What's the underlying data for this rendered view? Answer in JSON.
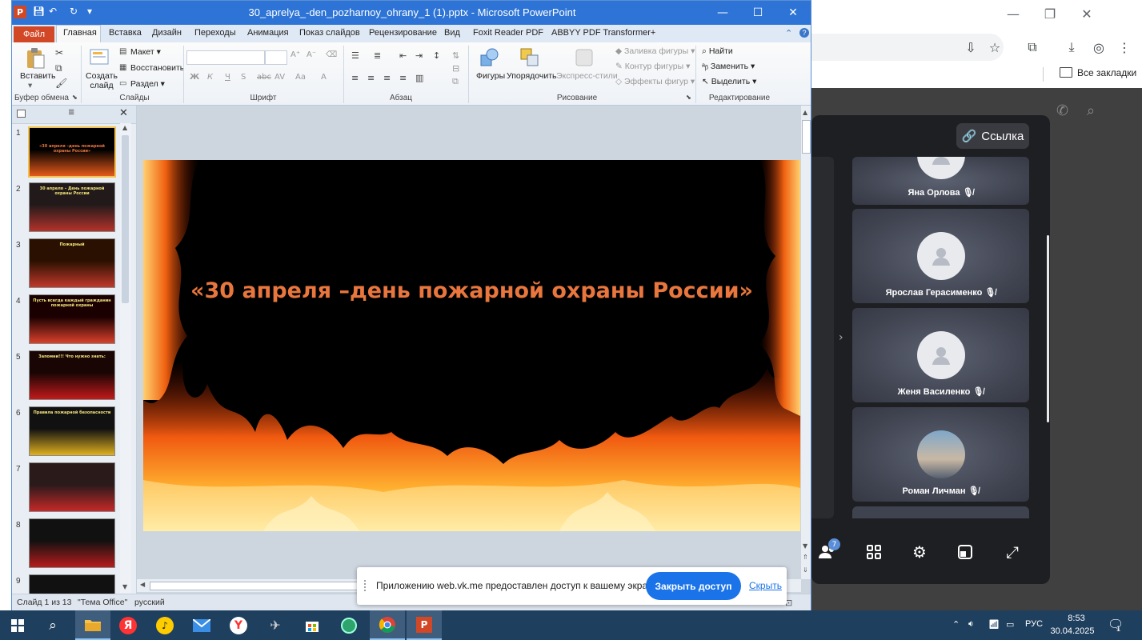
{
  "browser": {
    "bookmarks_label": "Все закладки",
    "vk": {
      "link_button": "Ссылка",
      "participants": [
        {
          "name": "Яна Орлова"
        },
        {
          "name": "Ярослав Герасименко"
        },
        {
          "name": "Женя Василенко"
        },
        {
          "name": "Роман Личман"
        }
      ],
      "participants_badge": "7"
    }
  },
  "ppt": {
    "title": "30_aprelya_-den_pozharnoy_ohrany_1 (1).pptx  -  Microsoft PowerPoint",
    "tabs": [
      "Файл",
      "Главная",
      "Вставка",
      "Дизайн",
      "Переходы",
      "Анимация",
      "Показ слайдов",
      "Рецензирование",
      "Вид",
      "Foxit Reader PDF",
      "ABBYY PDF Transformer+"
    ],
    "ribbon": {
      "clipboard": {
        "paste": "Вставить",
        "label": "Буфер обмена"
      },
      "slides": {
        "new_slide": "Создать слайд",
        "layout": "Макет",
        "reset": "Восстановить",
        "section": "Раздел",
        "label": "Слайды"
      },
      "font": {
        "label": "Шрифт"
      },
      "paragraph": {
        "label": "Абзац"
      },
      "drawing": {
        "shapes": "Фигуры",
        "arrange": "Упорядочить",
        "quick_styles": "Экспресс-стили",
        "fill": "Заливка фигуры",
        "outline": "Контур фигуры",
        "effects": "Эффекты фигур",
        "label": "Рисование"
      },
      "editing": {
        "find": "Найти",
        "replace": "Заменить",
        "select": "Выделить",
        "label": "Редактирование"
      }
    },
    "slide_thumbs": [
      {
        "num": "1",
        "caption": "«30 апреля –день пожарной охраны России»"
      },
      {
        "num": "2",
        "caption": "30 апреля – День пожарной охраны России"
      },
      {
        "num": "3",
        "caption": "Пожарный"
      },
      {
        "num": "4",
        "caption": "Пусть всегда каждый гражданин пожарной охраны"
      },
      {
        "num": "5",
        "caption": "Запомни!!! Что нужно знать:"
      },
      {
        "num": "6",
        "caption": "Правила пожарной безопасности"
      },
      {
        "num": "7",
        "caption": ""
      },
      {
        "num": "8",
        "caption": ""
      },
      {
        "num": "9",
        "caption": ""
      }
    ],
    "slide_title": "«30 апреля –день пожарной охраны России»",
    "status": {
      "slide": "Слайд 1 из 13",
      "theme": "\"Тема Office\"",
      "lang": "русский"
    }
  },
  "share_bar": {
    "text": "Приложению web.vk.me предоставлен доступ к вашему экрану.",
    "stop_button": "Закрыть доступ",
    "hide_link": "Скрыть"
  },
  "taskbar": {
    "lang": "РУС",
    "time": "8:53",
    "date": "30.04.2025",
    "notif_count": "1"
  }
}
